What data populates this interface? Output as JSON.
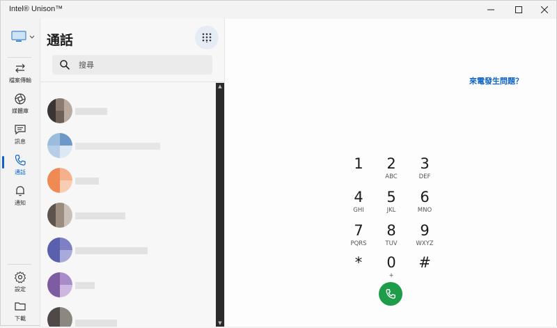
{
  "window": {
    "title": "Intel® Unison™",
    "controls": [
      "minimize-icon",
      "maximize-icon",
      "close-icon"
    ]
  },
  "rail": {
    "device_icon": "monitor-icon",
    "items": [
      {
        "label": "檔案傳輸",
        "icon": "transfer-arrows-icon"
      },
      {
        "label": "媒體庫",
        "icon": "aperture-icon"
      },
      {
        "label": "訊息",
        "icon": "chat-bubble-icon"
      },
      {
        "label": "通話",
        "icon": "phone-icon",
        "active": true
      },
      {
        "label": "通知",
        "icon": "bell-icon"
      }
    ],
    "bottom_items": [
      {
        "label": "設定",
        "icon": "gear-icon"
      },
      {
        "label": "下載",
        "icon": "folder-icon"
      }
    ]
  },
  "calls_panel": {
    "title": "通話",
    "search_placeholder": "搜尋",
    "contacts_count_visible": 7
  },
  "dialpad": {
    "help_link": "來電發生問題？",
    "keys": [
      {
        "digit": "1",
        "letters": ""
      },
      {
        "digit": "2",
        "letters": "ABC"
      },
      {
        "digit": "3",
        "letters": "DEF"
      },
      {
        "digit": "4",
        "letters": "GHI"
      },
      {
        "digit": "5",
        "letters": "JKL"
      },
      {
        "digit": "6",
        "letters": "MNO"
      },
      {
        "digit": "7",
        "letters": "PQRS"
      },
      {
        "digit": "8",
        "letters": "TUV"
      },
      {
        "digit": "9",
        "letters": "WXYZ"
      },
      {
        "digit": "*",
        "letters": ""
      },
      {
        "digit": "0",
        "letters": "+"
      },
      {
        "digit": "#",
        "letters": ""
      }
    ],
    "call_icon": "phone-call-icon"
  },
  "colors": {
    "accent": "#0e63c7",
    "call_green": "#1e9c4a"
  }
}
